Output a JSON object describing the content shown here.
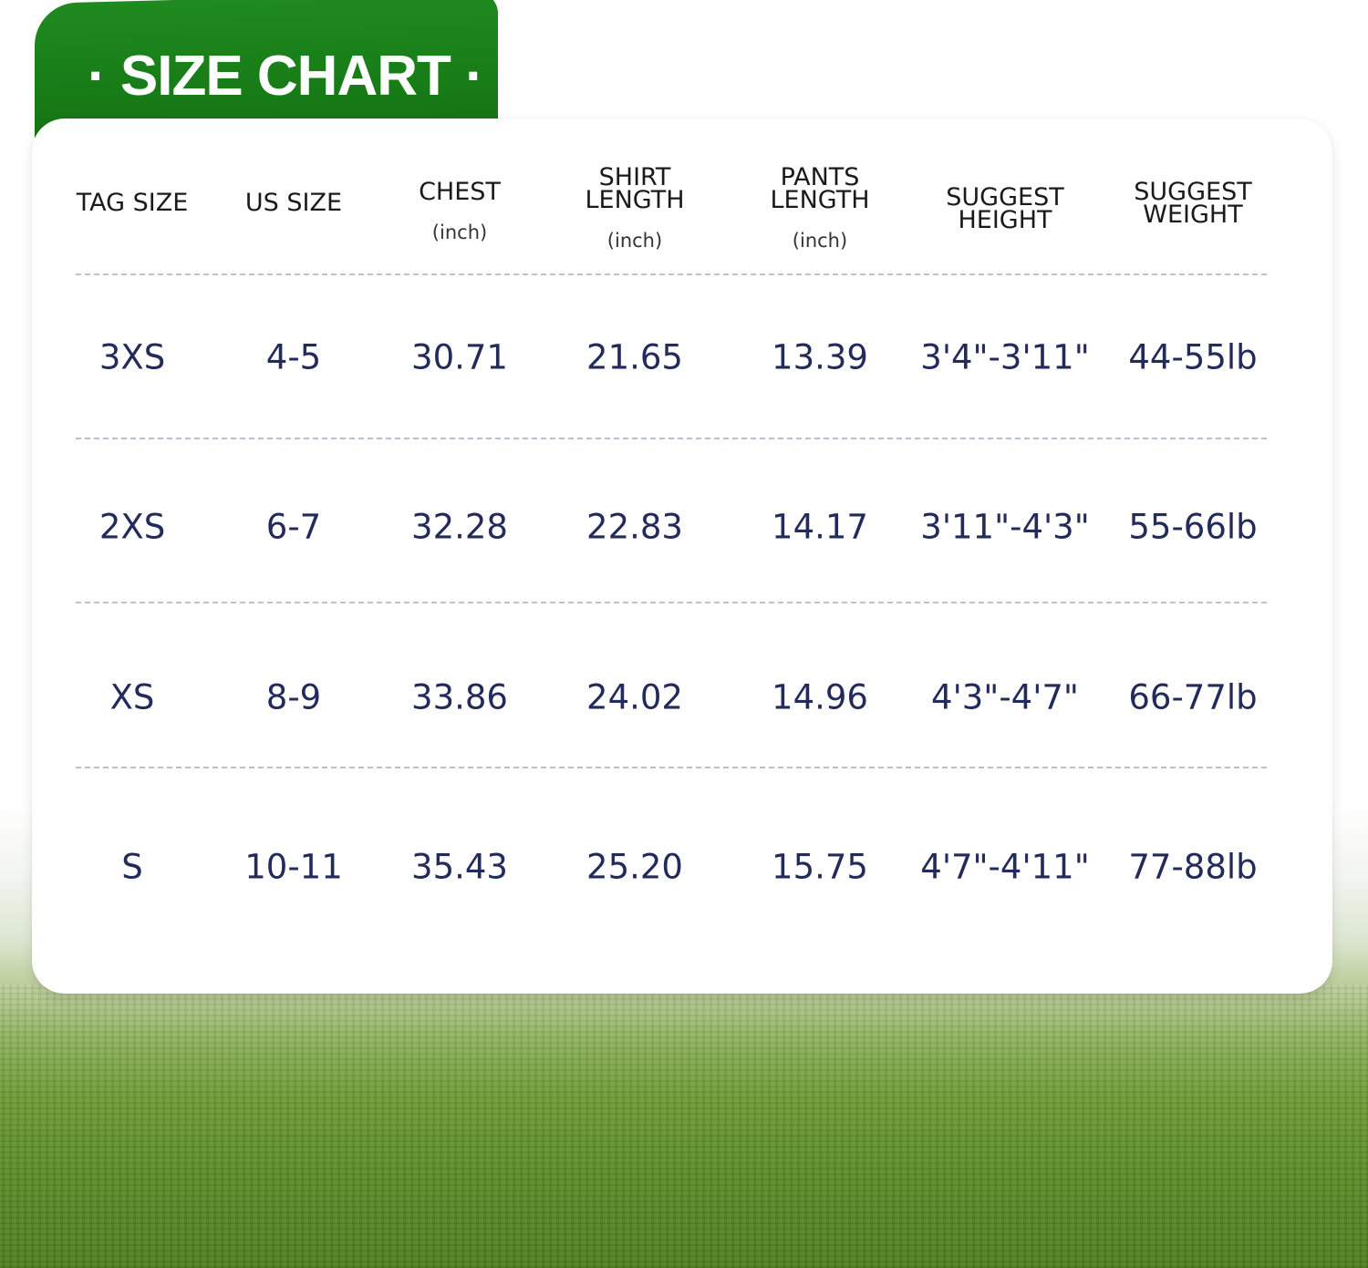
{
  "title": "· SIZE CHART ·",
  "columns": [
    {
      "label_lines": [
        "TAG SIZE"
      ],
      "unit": ""
    },
    {
      "label_lines": [
        "US SIZE"
      ],
      "unit": ""
    },
    {
      "label_lines": [
        "CHEST"
      ],
      "unit": "(inch)"
    },
    {
      "label_lines": [
        "SHIRT",
        "LENGTH"
      ],
      "unit": "(inch)"
    },
    {
      "label_lines": [
        "PANTS",
        "LENGTH"
      ],
      "unit": "(inch)"
    },
    {
      "label_lines": [
        "SUGGEST",
        "HEIGHT"
      ],
      "unit": ""
    },
    {
      "label_lines": [
        "SUGGEST",
        "WEIGHT"
      ],
      "unit": ""
    }
  ],
  "rows": [
    [
      "3XS",
      "4-5",
      "30.71",
      "21.65",
      "13.39",
      "3'4\"-3'11\"",
      "44-55lb"
    ],
    [
      "2XS",
      "6-7",
      "32.28",
      "22.83",
      "14.17",
      "3'11\"-4'3\"",
      "55-66lb"
    ],
    [
      "XS",
      "8-9",
      "33.86",
      "24.02",
      "14.96",
      "4'3\"-4'7\"",
      "66-77lb"
    ],
    [
      "S",
      "10-11",
      "35.43",
      "25.20",
      "15.75",
      "4'7\"-4'11\"",
      "77-88lb"
    ]
  ],
  "colors": {
    "tab_green": "#137312",
    "value_text": "#232a5c",
    "header_text": "#1a1a1a"
  }
}
